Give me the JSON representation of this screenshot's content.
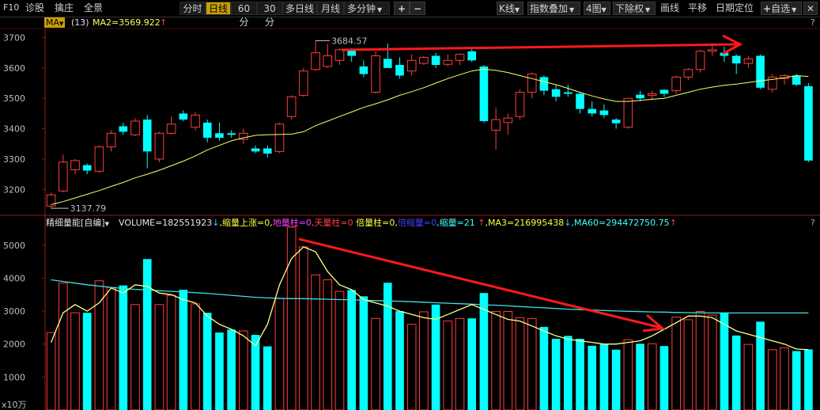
{
  "toolbar": {
    "left_items": [
      "F10",
      "诊股",
      "擒庄",
      "全景"
    ],
    "periods": [
      "分时",
      "日线",
      "60分",
      "30分",
      "多日线",
      "月线",
      "多分钟"
    ],
    "active_period": "日线",
    "plus": "+",
    "minus": "−",
    "right_items": [
      "K线",
      "指数叠加",
      "4图",
      "下除权",
      "画线",
      "平移",
      "日期定位",
      "自选"
    ],
    "help": "?"
  },
  "main_indicator": {
    "name": "MA",
    "period": "(13)",
    "value": "MA2=3569.922",
    "arrow": "↑"
  },
  "volume_indicator": {
    "name": "精细量能[自编]",
    "parts": [
      {
        "text": "VOLUME=182551923",
        "color": "#e8e8e8"
      },
      {
        "text": "↓",
        "color": "#40c0ff"
      },
      {
        "text": ",缩量上涨=0,",
        "color": "#ffff40"
      },
      {
        "text": "地量柱=0,",
        "color": "#ff40ff"
      },
      {
        "text": "天量柱=0",
        "color": "#ff4040"
      },
      {
        "text": " 倍量柱=0,",
        "color": "#ffff40"
      },
      {
        "text": "倍缩量=0",
        "color": "#4040ff"
      },
      {
        "text": ",缩量=21",
        "color": "#40ffff"
      },
      {
        "text": " ↑",
        "color": "#ff4040"
      },
      {
        "text": ",MA3=216995438",
        "color": "#ffff40"
      },
      {
        "text": "↓",
        "color": "#40c0ff"
      },
      {
        "text": ",MA60=294472750.75",
        "color": "#40ffff"
      },
      {
        "text": "↑",
        "color": "#ff4040"
      }
    ]
  },
  "price_axis": [
    "3700",
    "3600",
    "3500",
    "3400",
    "3300",
    "3200"
  ],
  "volume_axis": [
    "5000",
    "4000",
    "3000",
    "2000",
    "1000"
  ],
  "volume_unit": "x10万",
  "labels": {
    "high": "3684.57",
    "low": "3137.79"
  },
  "colors": {
    "up": "#ff3c3c",
    "down": "#00ffff",
    "ma": "#ffff66",
    "ma60": "#40e0e0",
    "arrow": "#ff1a1a",
    "active": "#c8a000"
  },
  "chart_data": {
    "type": "candlestick",
    "price_range": [
      3120,
      3730
    ],
    "volume_range_x10w": [
      0,
      5500
    ],
    "candles": [
      {
        "o": 3145,
        "h": 3190,
        "l": 3138,
        "c": 3182,
        "v": 2350,
        "up": true
      },
      {
        "o": 3195,
        "h": 3315,
        "l": 3190,
        "c": 3290,
        "v": 3850,
        "up": true
      },
      {
        "o": 3265,
        "h": 3300,
        "l": 3250,
        "c": 3295,
        "v": 2950,
        "up": true
      },
      {
        "o": 3280,
        "h": 3285,
        "l": 3250,
        "c": 3262,
        "v": 2950,
        "up": false
      },
      {
        "o": 3260,
        "h": 3345,
        "l": 3255,
        "c": 3340,
        "v": 3920,
        "up": true
      },
      {
        "o": 3340,
        "h": 3395,
        "l": 3325,
        "c": 3385,
        "v": 3720,
        "up": true
      },
      {
        "o": 3408,
        "h": 3420,
        "l": 3380,
        "c": 3390,
        "v": 3780,
        "up": false
      },
      {
        "o": 3380,
        "h": 3435,
        "l": 3375,
        "c": 3425,
        "v": 3200,
        "up": true
      },
      {
        "o": 3430,
        "h": 3445,
        "l": 3270,
        "c": 3325,
        "v": 4580,
        "up": false
      },
      {
        "o": 3300,
        "h": 3390,
        "l": 3290,
        "c": 3385,
        "v": 3200,
        "up": true
      },
      {
        "o": 3385,
        "h": 3440,
        "l": 3380,
        "c": 3415,
        "v": 3480,
        "up": true
      },
      {
        "o": 3450,
        "h": 3460,
        "l": 3425,
        "c": 3430,
        "v": 3650,
        "up": false
      },
      {
        "o": 3405,
        "h": 3455,
        "l": 3395,
        "c": 3445,
        "v": 3220,
        "up": true
      },
      {
        "o": 3420,
        "h": 3430,
        "l": 3355,
        "c": 3370,
        "v": 2950,
        "up": false
      },
      {
        "o": 3370,
        "h": 3420,
        "l": 3360,
        "c": 3385,
        "v": 2350,
        "up": false
      },
      {
        "o": 3385,
        "h": 3395,
        "l": 3370,
        "c": 3380,
        "v": 2440,
        "up": false
      },
      {
        "o": 3365,
        "h": 3400,
        "l": 3350,
        "c": 3385,
        "v": 2400,
        "up": true
      },
      {
        "o": 3335,
        "h": 3345,
        "l": 3320,
        "c": 3325,
        "v": 2280,
        "up": false
      },
      {
        "o": 3335,
        "h": 3345,
        "l": 3305,
        "c": 3318,
        "v": 1930,
        "up": false
      },
      {
        "o": 3325,
        "h": 3420,
        "l": 3320,
        "c": 3415,
        "v": 3380,
        "up": true
      },
      {
        "o": 3440,
        "h": 3510,
        "l": 3430,
        "c": 3505,
        "v": 5550,
        "up": true
      },
      {
        "o": 3510,
        "h": 3600,
        "l": 3505,
        "c": 3590,
        "v": 4950,
        "up": true
      },
      {
        "o": 3595,
        "h": 3690,
        "l": 3590,
        "c": 3650,
        "v": 4100,
        "up": true
      },
      {
        "o": 3605,
        "h": 3680,
        "l": 3600,
        "c": 3640,
        "v": 3950,
        "up": true
      },
      {
        "o": 3625,
        "h": 3665,
        "l": 3610,
        "c": 3660,
        "v": 3600,
        "up": true
      },
      {
        "o": 3660,
        "h": 3665,
        "l": 3620,
        "c": 3640,
        "v": 3640,
        "up": false
      },
      {
        "o": 3605,
        "h": 3625,
        "l": 3570,
        "c": 3580,
        "v": 3450,
        "up": false
      },
      {
        "o": 3520,
        "h": 3655,
        "l": 3515,
        "c": 3640,
        "v": 2780,
        "up": true
      },
      {
        "o": 3630,
        "h": 3680,
        "l": 3600,
        "c": 3600,
        "v": 3860,
        "up": false
      },
      {
        "o": 3610,
        "h": 3635,
        "l": 3565,
        "c": 3575,
        "v": 3000,
        "up": false
      },
      {
        "o": 3590,
        "h": 3645,
        "l": 3575,
        "c": 3625,
        "v": 2600,
        "up": true
      },
      {
        "o": 3615,
        "h": 3640,
        "l": 3610,
        "c": 3635,
        "v": 2980,
        "up": true
      },
      {
        "o": 3640,
        "h": 3650,
        "l": 3600,
        "c": 3610,
        "v": 3200,
        "up": false
      },
      {
        "o": 3612,
        "h": 3645,
        "l": 3605,
        "c": 3625,
        "v": 2700,
        "up": true
      },
      {
        "o": 3625,
        "h": 3648,
        "l": 3610,
        "c": 3645,
        "v": 2780,
        "up": true
      },
      {
        "o": 3655,
        "h": 3665,
        "l": 3620,
        "c": 3625,
        "v": 2780,
        "up": false
      },
      {
        "o": 3605,
        "h": 3610,
        "l": 3420,
        "c": 3425,
        "v": 3550,
        "up": false
      },
      {
        "o": 3395,
        "h": 3470,
        "l": 3330,
        "c": 3430,
        "v": 2990,
        "up": true
      },
      {
        "o": 3420,
        "h": 3450,
        "l": 3380,
        "c": 3435,
        "v": 2990,
        "up": true
      },
      {
        "o": 3440,
        "h": 3530,
        "l": 3430,
        "c": 3520,
        "v": 2800,
        "up": true
      },
      {
        "o": 3520,
        "h": 3585,
        "l": 3500,
        "c": 3580,
        "v": 2780,
        "up": true
      },
      {
        "o": 3570,
        "h": 3575,
        "l": 3510,
        "c": 3525,
        "v": 2520,
        "up": false
      },
      {
        "o": 3530,
        "h": 3545,
        "l": 3490,
        "c": 3505,
        "v": 2160,
        "up": false
      },
      {
        "o": 3520,
        "h": 3545,
        "l": 3505,
        "c": 3515,
        "v": 2250,
        "up": false
      },
      {
        "o": 3515,
        "h": 3520,
        "l": 3450,
        "c": 3465,
        "v": 2160,
        "up": false
      },
      {
        "o": 3465,
        "h": 3490,
        "l": 3440,
        "c": 3450,
        "v": 1950,
        "up": false
      },
      {
        "o": 3460,
        "h": 3480,
        "l": 3435,
        "c": 3445,
        "v": 2000,
        "up": false
      },
      {
        "o": 3430,
        "h": 3435,
        "l": 3400,
        "c": 3418,
        "v": 1830,
        "up": false
      },
      {
        "o": 3405,
        "h": 3500,
        "l": 3400,
        "c": 3500,
        "v": 2130,
        "up": true
      },
      {
        "o": 3500,
        "h": 3525,
        "l": 3490,
        "c": 3512,
        "v": 2010,
        "up": false
      },
      {
        "o": 3510,
        "h": 3525,
        "l": 3495,
        "c": 3515,
        "v": 2010,
        "up": true
      },
      {
        "o": 3515,
        "h": 3530,
        "l": 3505,
        "c": 3528,
        "v": 1940,
        "up": false
      },
      {
        "o": 3525,
        "h": 3575,
        "l": 3515,
        "c": 3570,
        "v": 2820,
        "up": true
      },
      {
        "o": 3570,
        "h": 3600,
        "l": 3560,
        "c": 3595,
        "v": 2740,
        "up": true
      },
      {
        "o": 3595,
        "h": 3660,
        "l": 3585,
        "c": 3655,
        "v": 2990,
        "up": true
      },
      {
        "o": 3655,
        "h": 3682,
        "l": 3640,
        "c": 3660,
        "v": 2880,
        "up": true
      },
      {
        "o": 3650,
        "h": 3670,
        "l": 3620,
        "c": 3640,
        "v": 2960,
        "up": false
      },
      {
        "o": 3640,
        "h": 3645,
        "l": 3580,
        "c": 3615,
        "v": 2260,
        "up": false
      },
      {
        "o": 3615,
        "h": 3640,
        "l": 3600,
        "c": 3630,
        "v": 1990,
        "up": true
      },
      {
        "o": 3640,
        "h": 3645,
        "l": 3530,
        "c": 3535,
        "v": 2680,
        "up": false
      },
      {
        "o": 3530,
        "h": 3580,
        "l": 3520,
        "c": 3570,
        "v": 1830,
        "up": true
      },
      {
        "o": 3565,
        "h": 3580,
        "l": 3545,
        "c": 3575,
        "v": 1890,
        "up": true
      },
      {
        "o": 3575,
        "h": 3580,
        "l": 3540,
        "c": 3545,
        "v": 1790,
        "up": false
      },
      {
        "o": 3540,
        "h": 3550,
        "l": 3290,
        "c": 3295,
        "v": 1840,
        "up": false
      }
    ],
    "ma_line": [
      3150,
      3160,
      3172,
      3184,
      3196,
      3210,
      3223,
      3238,
      3250,
      3263,
      3278,
      3293,
      3310,
      3330,
      3345,
      3360,
      3370,
      3378,
      3380,
      3381,
      3382,
      3390,
      3410,
      3425,
      3440,
      3455,
      3470,
      3482,
      3495,
      3510,
      3522,
      3535,
      3550,
      3565,
      3578,
      3590,
      3596,
      3592,
      3585,
      3575,
      3565,
      3555,
      3545,
      3533,
      3520,
      3508,
      3498,
      3490,
      3490,
      3493,
      3497,
      3500,
      3510,
      3520,
      3530,
      3537,
      3543,
      3547,
      3552,
      3558,
      3562,
      3568,
      3575,
      3572
    ],
    "vol_ma": [
      2050,
      2950,
      3200,
      3000,
      3250,
      3700,
      3550,
      3800,
      3750,
      3550,
      3500,
      3350,
      3250,
      2850,
      2600,
      2450,
      2250,
      1950,
      2600,
      3800,
      4600,
      4950,
      4800,
      4200,
      3800,
      3650,
      3350,
      3250,
      3150,
      3000,
      2900,
      2800,
      2750,
      2900,
      3050,
      3200,
      3050,
      2900,
      2750,
      2700,
      2550,
      2400,
      2250,
      2150,
      2100,
      2050,
      2000,
      2000,
      2050,
      2100,
      2250,
      2450,
      2650,
      2850,
      2850,
      2800,
      2600,
      2400,
      2300,
      2200,
      2100,
      2000,
      1850,
      1830
    ],
    "vol_ma60": [
      3950,
      3900,
      3850,
      3800,
      3760,
      3720,
      3690,
      3660,
      3640,
      3620,
      3600,
      3580,
      3560,
      3540,
      3510,
      3480,
      3450,
      3420,
      3400,
      3390,
      3380,
      3380,
      3370,
      3360,
      3350,
      3340,
      3330,
      3320,
      3310,
      3300,
      3285,
      3270,
      3255,
      3240,
      3225,
      3210,
      3195,
      3180,
      3160,
      3140,
      3120,
      3100,
      3080,
      3060,
      3045,
      3035,
      3020,
      3005,
      2995,
      2985,
      2975,
      2970,
      2960,
      2955,
      2950,
      2945,
      2945,
      2945,
      2945,
      2945,
      2945,
      2945,
      2945,
      2945
    ]
  }
}
